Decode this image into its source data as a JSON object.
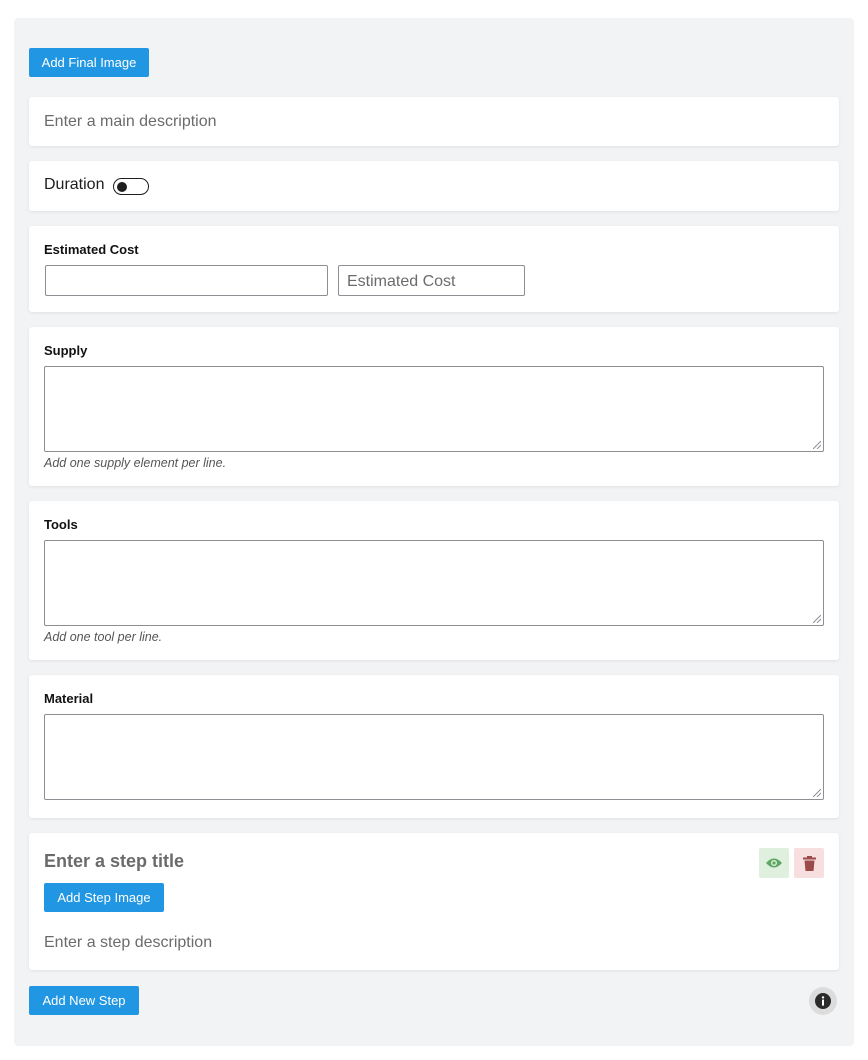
{
  "buttons": {
    "add_final_image": "Add Final Image",
    "add_step_image": "Add Step Image",
    "add_new_step": "Add New Step"
  },
  "main_description": {
    "placeholder": "Enter a main description"
  },
  "duration": {
    "label": "Duration",
    "enabled": false
  },
  "estimated_cost": {
    "label": "Estimated Cost",
    "currency_value": "",
    "cost_placeholder": "Estimated Cost"
  },
  "supply": {
    "label": "Supply",
    "value": "",
    "help": "Add one supply element per line."
  },
  "tools": {
    "label": "Tools",
    "value": "",
    "help": "Add one tool per line."
  },
  "material": {
    "label": "Material",
    "value": ""
  },
  "step": {
    "title_placeholder": "Enter a step title",
    "description_placeholder": "Enter a step description"
  },
  "icons": {
    "visibility": "eye-icon",
    "delete": "trash-icon",
    "info": "info-icon"
  },
  "colors": {
    "primary": "#2196e3",
    "eye_bg": "#dff0df",
    "eye_fg": "#5fa863",
    "trash_bg": "#f7dfe0",
    "trash_fg": "#9b4a4a"
  }
}
